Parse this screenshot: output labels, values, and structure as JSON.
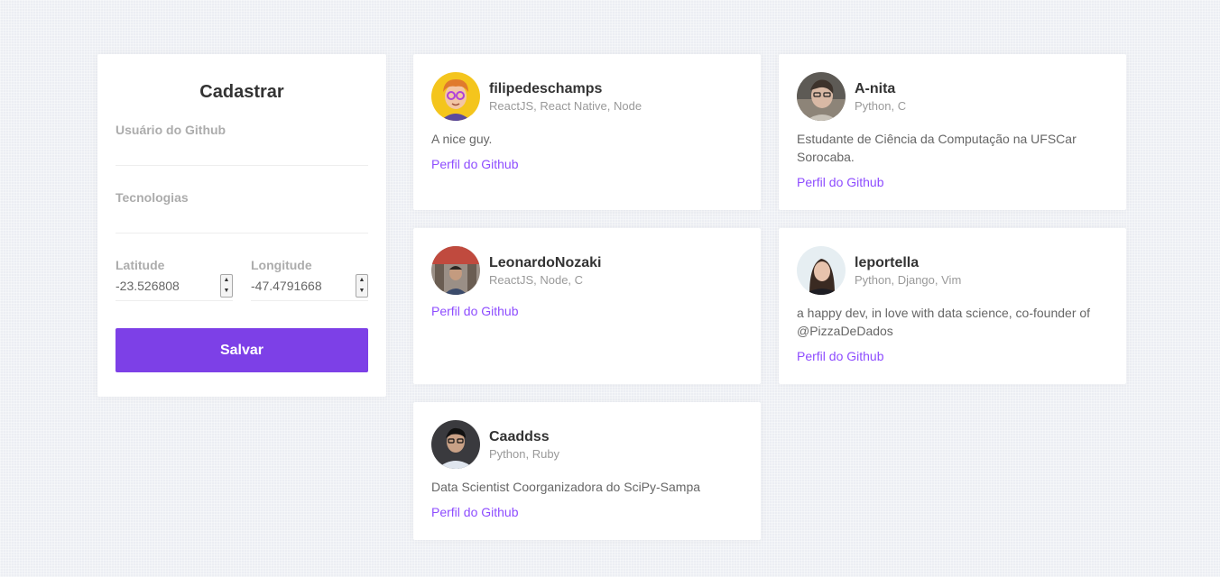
{
  "form": {
    "title": "Cadastrar",
    "github_label": "Usuário do Github",
    "github_value": "",
    "techs_label": "Tecnologias",
    "techs_value": "",
    "latitude_label": "Latitude",
    "latitude_value": "-23.526808",
    "longitude_label": "Longitude",
    "longitude_value": "-47.4791668",
    "save_label": "Salvar"
  },
  "devs": [
    {
      "name": "filipedeschamps",
      "techs": "ReactJS, React Native, Node",
      "bio": "A nice guy.",
      "link": "Perfil do Github",
      "avatar_icon": "cartoon-avatar"
    },
    {
      "name": "A-nita",
      "techs": "Python, C",
      "bio": "Estudante de Ciência da Computação na UFSCar Sorocaba.",
      "link": "Perfil do Github",
      "avatar_icon": "photo-avatar"
    },
    {
      "name": "LeonardoNozaki",
      "techs": "ReactJS, Node, C",
      "bio": "",
      "link": "Perfil do Github",
      "avatar_icon": "photo-avatar"
    },
    {
      "name": "leportella",
      "techs": "Python, Django, Vim",
      "bio": "a happy dev, in love with data science, co-founder of @PizzaDeDados",
      "link": "Perfil do Github",
      "avatar_icon": "photo-avatar"
    },
    {
      "name": "Caaddss",
      "techs": "Python, Ruby",
      "bio": "Data Scientist Coorganizadora do SciPy-Sampa",
      "link": "Perfil do Github",
      "avatar_icon": "photo-avatar"
    }
  ],
  "colors": {
    "accent": "#7d40e7",
    "link": "#8e4dff",
    "background": "#eceef3"
  }
}
